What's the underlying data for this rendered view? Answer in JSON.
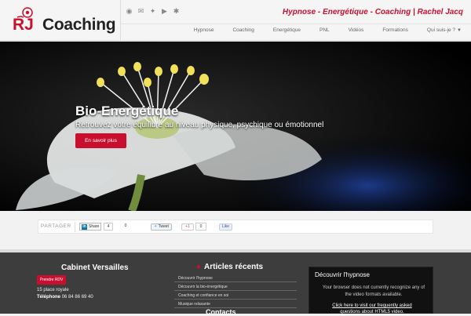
{
  "logo": {
    "mark": "RJ",
    "text": "Coaching"
  },
  "social_icons": [
    "rss-icon",
    "email-icon",
    "twitter-icon",
    "youtube-icon",
    "yelp-icon"
  ],
  "tagline": "Hypnose - Energétique - Coaching | Rachel Jacq",
  "nav": {
    "items": [
      {
        "label": "Hypnose"
      },
      {
        "label": "Coaching"
      },
      {
        "label": "Energétique"
      },
      {
        "label": "PNL"
      },
      {
        "label": "Vidéos"
      },
      {
        "label": "Formations"
      },
      {
        "label": "Qui suis-je ?"
      }
    ]
  },
  "hero": {
    "title": "Bio-Energétique",
    "subtitle": "Retrouvez votre équilibre au niveau physique, psychique ou émotionnel",
    "button": "En savoir plus"
  },
  "share": {
    "label": "PARTAGER",
    "linkedin": "Share",
    "linkedin_count": "4",
    "count2": "0",
    "tweet": "Tweet",
    "gplus": "+1",
    "gplus_count": "0",
    "like": "Like"
  },
  "footer": {
    "cabinet": {
      "title": "Cabinet Versailles",
      "button": "Prendre RDV",
      "address": "15 place royale",
      "tel_label": "Téléphone",
      "tel": "06 84 86 69 40"
    },
    "articles": {
      "title": "Articles récents",
      "items": [
        "Découvrir l'hypnose",
        "Découvrir la bio-énergétique",
        "Coaching et confiance en soi",
        "Musique relaxante"
      ],
      "next_title": "Contacts"
    },
    "video": {
      "title": "Découvrir l'hypnose",
      "message": "Your browser does not currently recognize any of the video formats available.",
      "link": "Click here to visit our frequently asked questions about HTML5 video."
    }
  },
  "colors": {
    "accent": "#c8102e",
    "footer_bg": "#3d3d3d"
  }
}
